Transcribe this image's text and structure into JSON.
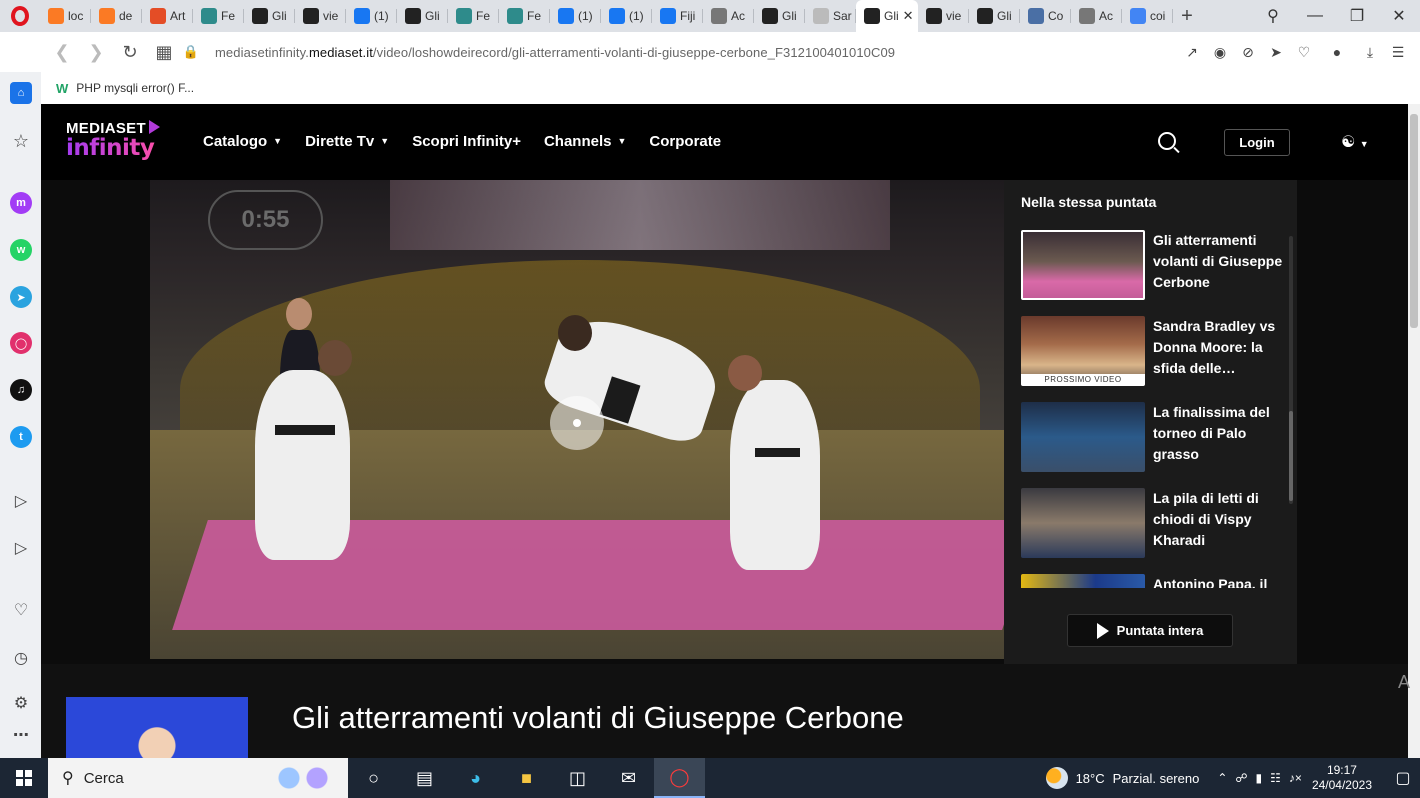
{
  "browser": {
    "tabs": [
      {
        "label": "loc",
        "icon": "xampp-icon",
        "color": "#fb7a24"
      },
      {
        "label": "de",
        "icon": "xampp-icon",
        "color": "#fb7a24"
      },
      {
        "label": "Art",
        "icon": "joomla-icon",
        "color": "#e44d26"
      },
      {
        "label": "Fe",
        "icon": "globe-icon",
        "color": "#2e8b8b"
      },
      {
        "label": "Gli",
        "icon": "mediaset-icon",
        "color": "#222"
      },
      {
        "label": "vie",
        "icon": "mediaset-icon",
        "color": "#222"
      },
      {
        "label": "(1)",
        "icon": "facebook-icon",
        "color": "#1877f2"
      },
      {
        "label": "Gli",
        "icon": "mediaset-icon",
        "color": "#222"
      },
      {
        "label": "Fe",
        "icon": "globe-icon",
        "color": "#2e8b8b"
      },
      {
        "label": "Fe",
        "icon": "globe-icon",
        "color": "#2e8b8b"
      },
      {
        "label": "(1)",
        "icon": "facebook-icon",
        "color": "#1877f2"
      },
      {
        "label": "(1)",
        "icon": "facebook-icon",
        "color": "#1877f2"
      },
      {
        "label": "Fiji",
        "icon": "facebook-icon",
        "color": "#1877f2"
      },
      {
        "label": "Ac",
        "icon": "apps-icon",
        "color": "#777"
      },
      {
        "label": "Gli",
        "icon": "mediaset-icon",
        "color": "#222"
      },
      {
        "label": "Sar",
        "icon": "loading-icon",
        "color": "#bbb"
      },
      {
        "label": "Gli",
        "icon": "mediaset-icon",
        "color": "#222",
        "active": true
      },
      {
        "label": "vie",
        "icon": "mediaset-icon",
        "color": "#222"
      },
      {
        "label": "Gli",
        "icon": "mediaset-icon",
        "color": "#222"
      },
      {
        "label": "Co",
        "icon": "globe-icon",
        "color": "#4a6fa5"
      },
      {
        "label": "Ac",
        "icon": "apps-icon",
        "color": "#777"
      },
      {
        "label": "coi",
        "icon": "google-icon",
        "color": "#4285f4"
      }
    ],
    "new_tab": "+",
    "url_host": "mediasetinfinity.mediaset.it",
    "url_pre": "mediasetinfinity.",
    "url_domain": "mediaset.it",
    "url_path": "/video/loshowdeirecord/gli-atterramenti-volanti-di-giuseppe-cerbone_F312100401010C09",
    "bookmark": "PHP mysqli error() F..."
  },
  "site": {
    "logo_top": "MEDIASET",
    "logo_bottom": "infinity",
    "menu": [
      {
        "label": "Catalogo",
        "caret": true
      },
      {
        "label": "Dirette Tv",
        "caret": true
      },
      {
        "label": "Scopri Infinity+",
        "caret": false
      },
      {
        "label": "Channels",
        "caret": true
      },
      {
        "label": "Corporate",
        "caret": false
      }
    ],
    "login": "Login"
  },
  "video": {
    "timer": "0:55"
  },
  "panel": {
    "title": "Nella stessa puntata",
    "episodes": [
      {
        "title": "Gli atterramenti volanti di Giuseppe Cerbone",
        "selected": true,
        "next": ""
      },
      {
        "title": "Sandra Bradley vs Donna Moore: la sfida delle…",
        "selected": false,
        "next": "PROSSIMO VIDEO"
      },
      {
        "title": "La finalissima del torneo di Palo grasso",
        "selected": false,
        "next": ""
      },
      {
        "title": "La pila di letti di chiodi di Vispy Kharadi",
        "selected": false,
        "next": ""
      },
      {
        "title": "Antonino Papa, il",
        "selected": false,
        "next": ""
      }
    ],
    "full_episode": "Puntata intera"
  },
  "below": {
    "title": "Gli atterramenti volanti di Giuseppe Cerbone",
    "peek": "A"
  },
  "taskbar": {
    "search": "Cerca",
    "weather_temp": "18°C",
    "weather_desc": "Parzial. sereno",
    "time": "19:17",
    "date": "24/04/2023"
  }
}
